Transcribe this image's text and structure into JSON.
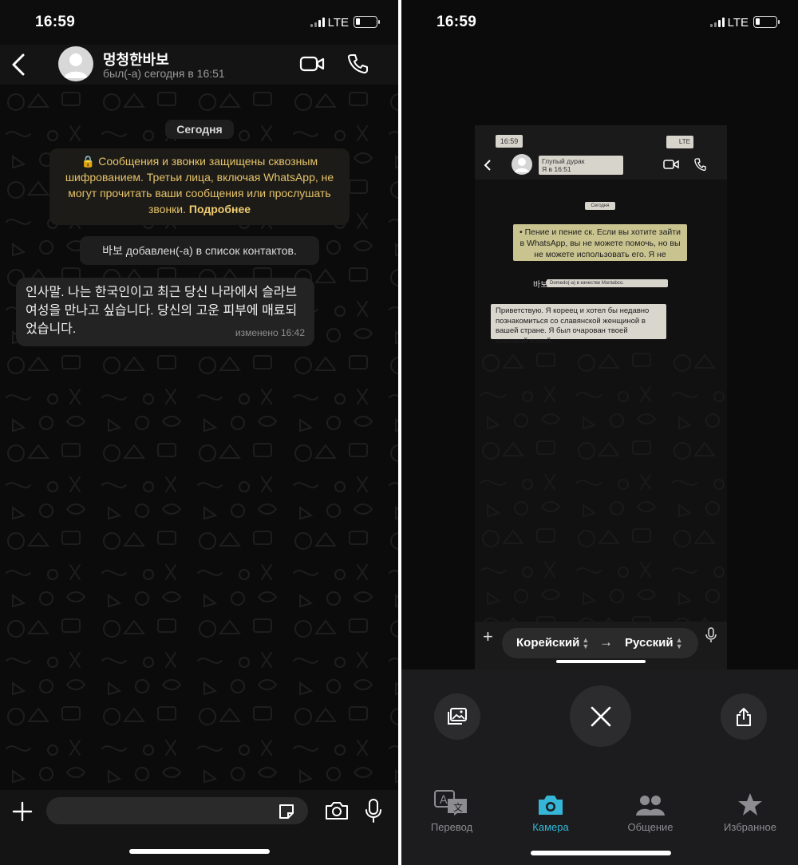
{
  "status_bar": {
    "time": "16:59",
    "network": "LTE"
  },
  "chat": {
    "contact_name": "멍청한바보",
    "contact_status": "был(-а) сегодня в 16:51",
    "date_chip": "Сегодня",
    "encryption_notice": "Сообщения и звонки защищены сквозным шифрованием. Третьи лица, включая WhatsApp, не могут прочитать ваши сообщения или прослушать звонки.",
    "encryption_link": "Подробнее",
    "contact_added": "바보 добавлен(-а) в список контактов.",
    "message_text": "인사말. 나는 한국인이고 최근 당신 나라에서 슬라브 여성을 만나고 싶습니다. 당신의 고운 피부에 매료되었습니다.",
    "message_meta": "изменено 16:42",
    "input_placeholder": ""
  },
  "translator": {
    "preview": {
      "time": "16:59",
      "network": "LTE",
      "name_overlay": "Глупый дурак",
      "status_overlay": "Я в 16:51",
      "date_overlay": "Сегодня",
      "notice_translation": "• Пение и пение ск. Если вы хотите зайти в WhatsApp, вы не можете помочь, но вы не можете использовать его. Я не",
      "added_prefix": "바보",
      "added_overlay": "Domedo(-a) в качестве Montabco.",
      "message_translation": "Приветствую. Я кореец и хотел бы недавно познакомиться со славянской женщиной в вашей стране. Я был очарован твоей красивой кожей."
    },
    "source_language": "Корейский",
    "target_language": "Русский",
    "tabs": [
      {
        "label": "Перевод",
        "icon": "translate-icon"
      },
      {
        "label": "Камера",
        "icon": "camera-icon"
      },
      {
        "label": "Общение",
        "icon": "people-icon"
      },
      {
        "label": "Избранное",
        "icon": "star-icon"
      }
    ],
    "active_tab": "Камера",
    "colors": {
      "accent": "#35b6d6",
      "notice_text": "#e6c36a"
    }
  }
}
